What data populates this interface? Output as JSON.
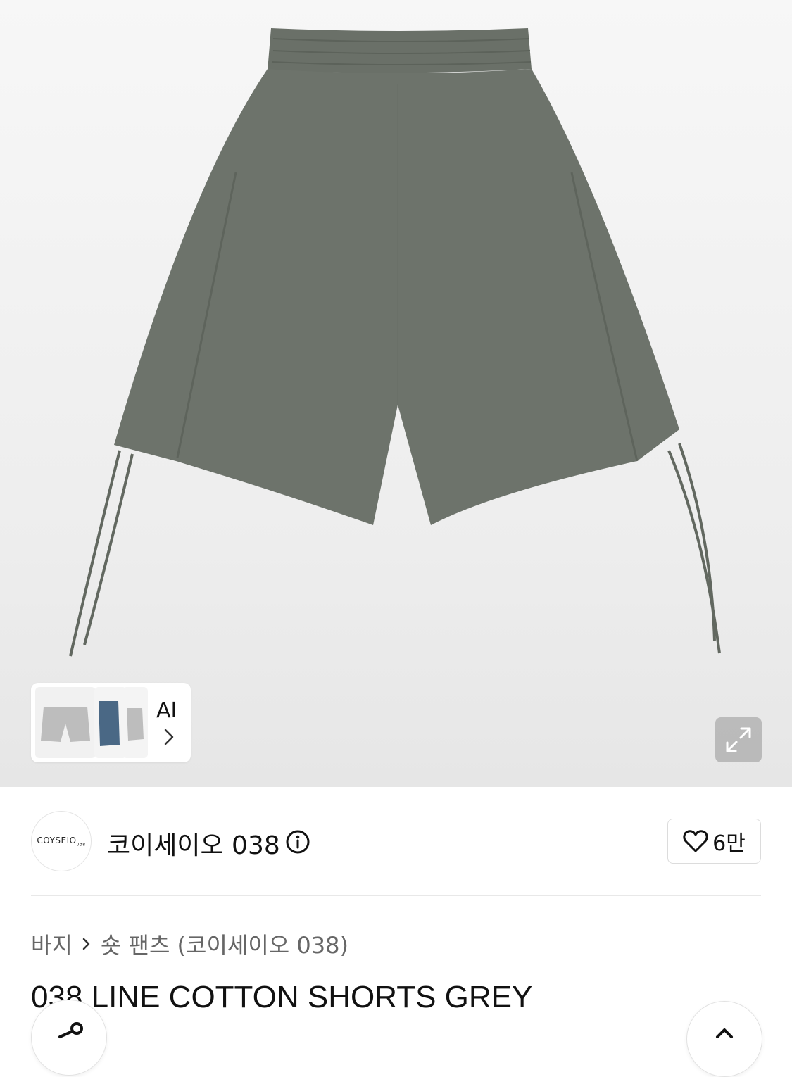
{
  "gallery": {
    "thumbnail_tag": "AI"
  },
  "brand": {
    "logo_text": "COYSEIO",
    "logo_suffix": "038",
    "name": "코이세이오 038",
    "like_count": "6만"
  },
  "breadcrumb": {
    "category": "바지",
    "subcategory": "숏 팬츠 (코이세이오 038)"
  },
  "product": {
    "title": "038 LINE COTTON SHORTS GREY"
  },
  "colors": {
    "product_fill": "#6d736b",
    "thumb_grey": "#bdbdbd",
    "thumb_blue": "#4a6885"
  }
}
